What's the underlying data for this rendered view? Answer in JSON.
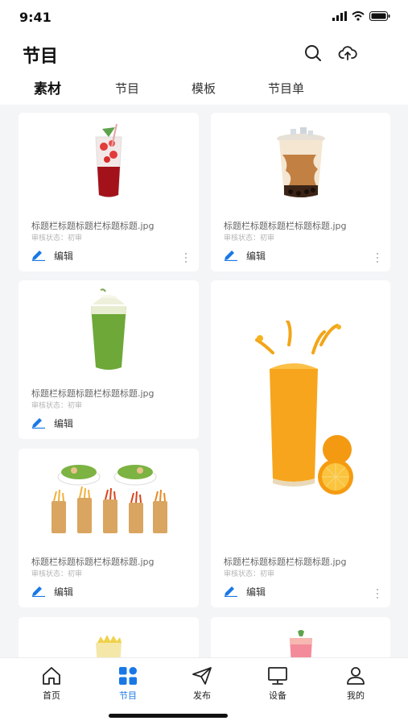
{
  "status": {
    "time": "9:41"
  },
  "header": {
    "title": "节目",
    "search_icon": "search-icon",
    "upload_icon": "cloud-upload-icon"
  },
  "tabs": [
    {
      "label": "素材",
      "active": true
    },
    {
      "label": "节目",
      "active": false
    },
    {
      "label": "模板",
      "active": false
    },
    {
      "label": "节目单",
      "active": false
    }
  ],
  "cards": [
    {
      "image": "strawberry-drink",
      "title": "标题栏标题标题栏标题标题.jpg",
      "status": "审核状态：初审",
      "edit_label": "编辑"
    },
    {
      "image": "bubble-tea",
      "title": "标题栏标题标题栏标题标题.jpg",
      "status": "审核状态：初审",
      "edit_label": "编辑"
    },
    {
      "image": "matcha-frappe",
      "title": "标题栏标题标题栏标题标题.jpg",
      "status": "审核状态：初审",
      "edit_label": "编辑"
    },
    {
      "image": "orange-juice",
      "title": "标题栏标题标题栏标题标题.jpg",
      "status": "审核状态：初审",
      "edit_label": "编辑"
    },
    {
      "image": "salads-and-fries",
      "title": "标题栏标题标题栏标题标题.jpg",
      "status": "审核状态：初审",
      "edit_label": "编辑"
    },
    {
      "image": "cake-cup"
    },
    {
      "image": "fruit-tea"
    }
  ],
  "tabbar": [
    {
      "label": "首页",
      "icon": "home-icon",
      "active": false
    },
    {
      "label": "节目",
      "icon": "grid-icon",
      "active": true
    },
    {
      "label": "发布",
      "icon": "send-icon",
      "active": false
    },
    {
      "label": "设备",
      "icon": "monitor-icon",
      "active": false
    },
    {
      "label": "我的",
      "icon": "user-icon",
      "active": false
    }
  ],
  "colors": {
    "accent": "#1a78e6",
    "background": "#f4f5f7",
    "card": "#ffffff"
  }
}
